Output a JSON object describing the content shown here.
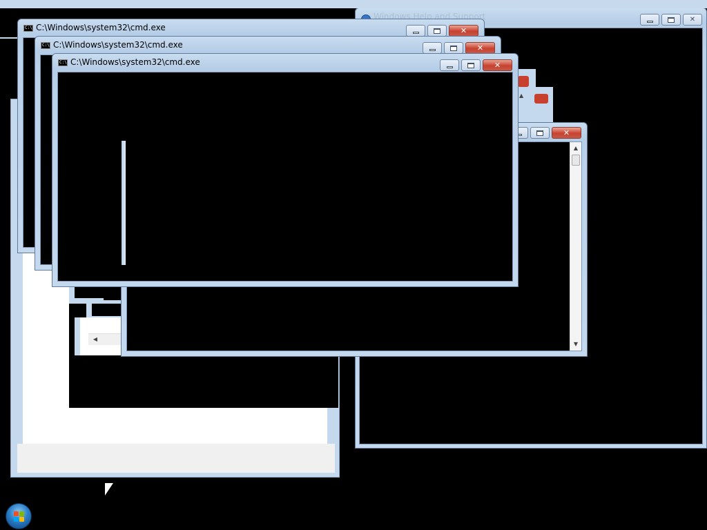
{
  "windows": {
    "title_text": "C:\\Windows\\system32\\cmd.exe",
    "cmd_icon_glyph": "C:\\",
    "background_title_partial": "Windows Help and Support"
  },
  "controls": {
    "minimize_glyph": "",
    "maximize_glyph": "",
    "close_glyph": "✕",
    "scroll_up": "▲",
    "scroll_down": "▼",
    "scroll_left": "◀"
  },
  "colors": {
    "desktop": "#000000",
    "close_button": "#c8412f",
    "frame_blue": "#bcd2ea"
  },
  "taskbar": {
    "start_button_icon": "windows-orb-icon"
  }
}
